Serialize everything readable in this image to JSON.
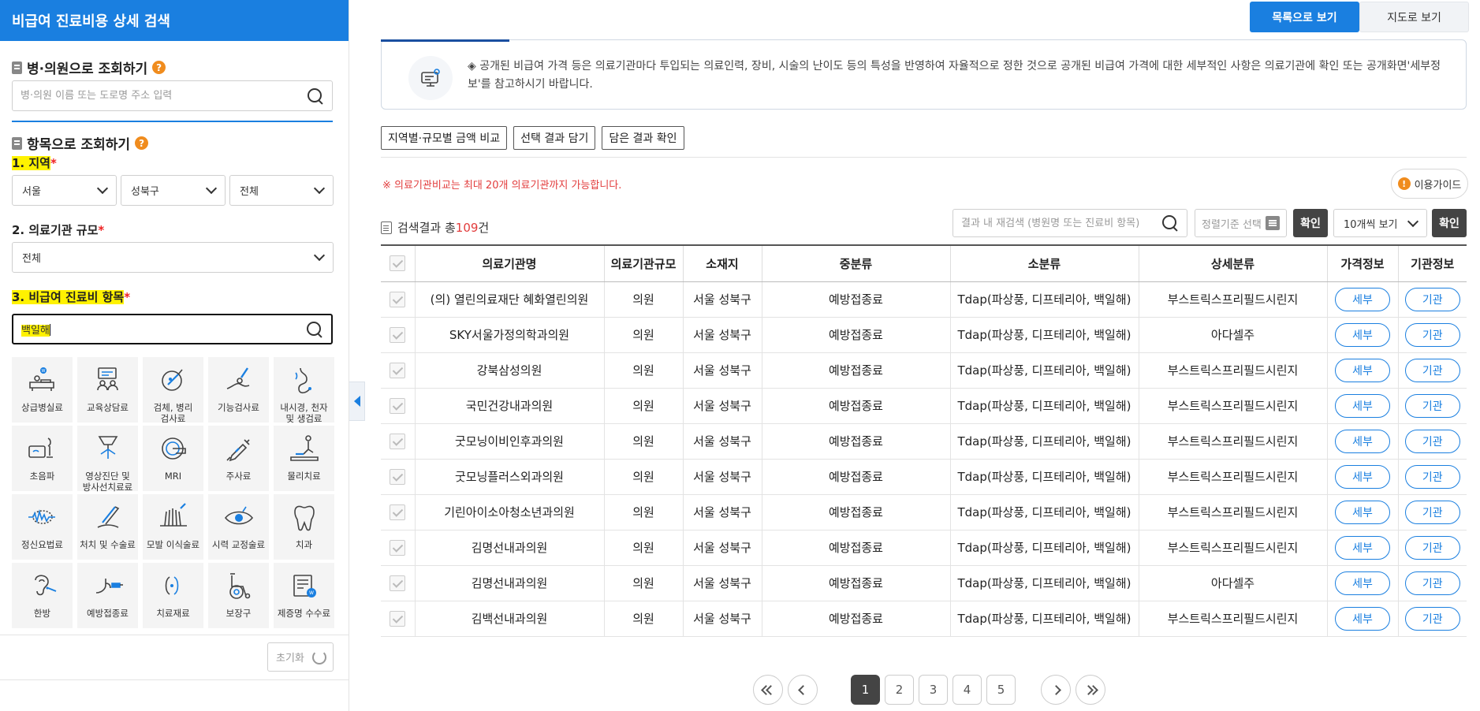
{
  "sidebar": {
    "title": "비급여 진료비용 상세 검색",
    "hospital_section": {
      "title": "병·의원으로 조회하기",
      "help": "?",
      "search_placeholder": "병·의원 이름 또는 도로명 주소 입력"
    },
    "item_section": {
      "title": "항목으로 조회하기",
      "help": "?"
    },
    "region": {
      "label": "1. 지역",
      "required": "*",
      "city": "서울",
      "district": "성북구",
      "area": "전체"
    },
    "scale": {
      "label": "2. 의료기관 규모",
      "required": "*",
      "value": "전체"
    },
    "item": {
      "label": "3. 비급여 진료비 항목",
      "required": "*",
      "value": "백일해"
    },
    "categories": [
      {
        "label": "상급병실료",
        "icon": "hospital-bed-icon"
      },
      {
        "label": "교육상담료",
        "icon": "counseling-icon"
      },
      {
        "label": "검체, 병리\n검사료",
        "icon": "specimen-test-icon"
      },
      {
        "label": "기능검사료",
        "icon": "function-test-icon"
      },
      {
        "label": "내시경, 천자\n및 생검료",
        "icon": "endoscope-icon"
      },
      {
        "label": "초음파",
        "icon": "ultrasound-icon"
      },
      {
        "label": "영상진단 및\n방사선치료료",
        "icon": "xray-icon"
      },
      {
        "label": "MRI",
        "icon": "mri-icon"
      },
      {
        "label": "주사료",
        "icon": "syringe-icon"
      },
      {
        "label": "물리치료",
        "icon": "physical-therapy-icon"
      },
      {
        "label": "정신요법료",
        "icon": "brainwave-icon"
      },
      {
        "label": "처치 및 수술료",
        "icon": "surgery-icon"
      },
      {
        "label": "모발 이식술료",
        "icon": "hair-transplant-icon"
      },
      {
        "label": "시력 교정술료",
        "icon": "eye-icon"
      },
      {
        "label": "치과",
        "icon": "tooth-icon"
      },
      {
        "label": "한방",
        "icon": "acupuncture-ear-icon"
      },
      {
        "label": "예방접종료",
        "icon": "vaccination-icon"
      },
      {
        "label": "치료재료",
        "icon": "treatment-material-icon"
      },
      {
        "label": "보장구",
        "icon": "wheelchair-icon"
      },
      {
        "label": "제증명 수수료",
        "icon": "certificate-icon"
      }
    ],
    "reset_label": "초기화"
  },
  "view": {
    "list_label": "목록으로 보기",
    "map_label": "지도로 보기"
  },
  "notice": "◈ 공개된 비급여 가격 등은 의료기관마다 투입되는 의료인력, 장비, 시술의 난이도 등의 특성을 반영하여 자율적으로 정한 것으로 공개된 비급여 가격에 대한 세부적인 사항은 의료기관에 확인 또는 공개화면'세부정보'를 참고하시기 바랍니다.",
  "tools": {
    "compare": "지역별·규모별 금액 비교",
    "save": "선택 결과 담기",
    "check": "담은 결과 확인"
  },
  "warning": "※ 의료기관비교는 최대 20개 의료기관까지 가능합니다.",
  "guide_label": "이용가이드",
  "results": {
    "prefix": "검색결과 총 ",
    "count": "109",
    "suffix": "건",
    "search_placeholder": "결과 내 재검색 (병원명 또는 진료비 항목)",
    "sort_placeholder": "정렬기준 선택",
    "confirm": "확인",
    "per_page": "10개씩 보기"
  },
  "table": {
    "headers": [
      "의료기관명",
      "의료기관규모",
      "소재지",
      "중분류",
      "소분류",
      "상세분류",
      "가격정보",
      "기관정보"
    ],
    "detail_label": "세부",
    "org_label": "기관",
    "rows": [
      [
        "(의) 열린의료재단 혜화열린의원",
        "의원",
        "서울 성북구",
        "예방접종료",
        "Tdap(파상풍, 디프테리아, 백일해)",
        "부스트릭스프리필드시린지"
      ],
      [
        "SKY서울가정의학과의원",
        "의원",
        "서울 성북구",
        "예방접종료",
        "Tdap(파상풍, 디프테리아, 백일해)",
        "아다셀주"
      ],
      [
        "강북삼성의원",
        "의원",
        "서울 성북구",
        "예방접종료",
        "Tdap(파상풍, 디프테리아, 백일해)",
        "부스트릭스프리필드시린지"
      ],
      [
        "국민건강내과의원",
        "의원",
        "서울 성북구",
        "예방접종료",
        "Tdap(파상풍, 디프테리아, 백일해)",
        "부스트릭스프리필드시린지"
      ],
      [
        "굿모닝이비인후과의원",
        "의원",
        "서울 성북구",
        "예방접종료",
        "Tdap(파상풍, 디프테리아, 백일해)",
        "부스트릭스프리필드시린지"
      ],
      [
        "굿모닝플러스외과의원",
        "의원",
        "서울 성북구",
        "예방접종료",
        "Tdap(파상풍, 디프테리아, 백일해)",
        "부스트릭스프리필드시린지"
      ],
      [
        "기린아이소아청소년과의원",
        "의원",
        "서울 성북구",
        "예방접종료",
        "Tdap(파상풍, 디프테리아, 백일해)",
        "부스트릭스프리필드시린지"
      ],
      [
        "김명선내과의원",
        "의원",
        "서울 성북구",
        "예방접종료",
        "Tdap(파상풍, 디프테리아, 백일해)",
        "부스트릭스프리필드시린지"
      ],
      [
        "김명선내과의원",
        "의원",
        "서울 성북구",
        "예방접종료",
        "Tdap(파상풍, 디프테리아, 백일해)",
        "아다셀주"
      ],
      [
        "김백선내과의원",
        "의원",
        "서울 성북구",
        "예방접종료",
        "Tdap(파상풍, 디프테리아, 백일해)",
        "부스트릭스프리필드시린지"
      ]
    ]
  },
  "pager": {
    "pages": [
      "1",
      "2",
      "3",
      "4",
      "5"
    ],
    "current": "1"
  },
  "colors": {
    "accent": "#1a7fe0",
    "highlight": "#fff200",
    "warning": "#e23c3c",
    "help": "#f08c1e"
  }
}
